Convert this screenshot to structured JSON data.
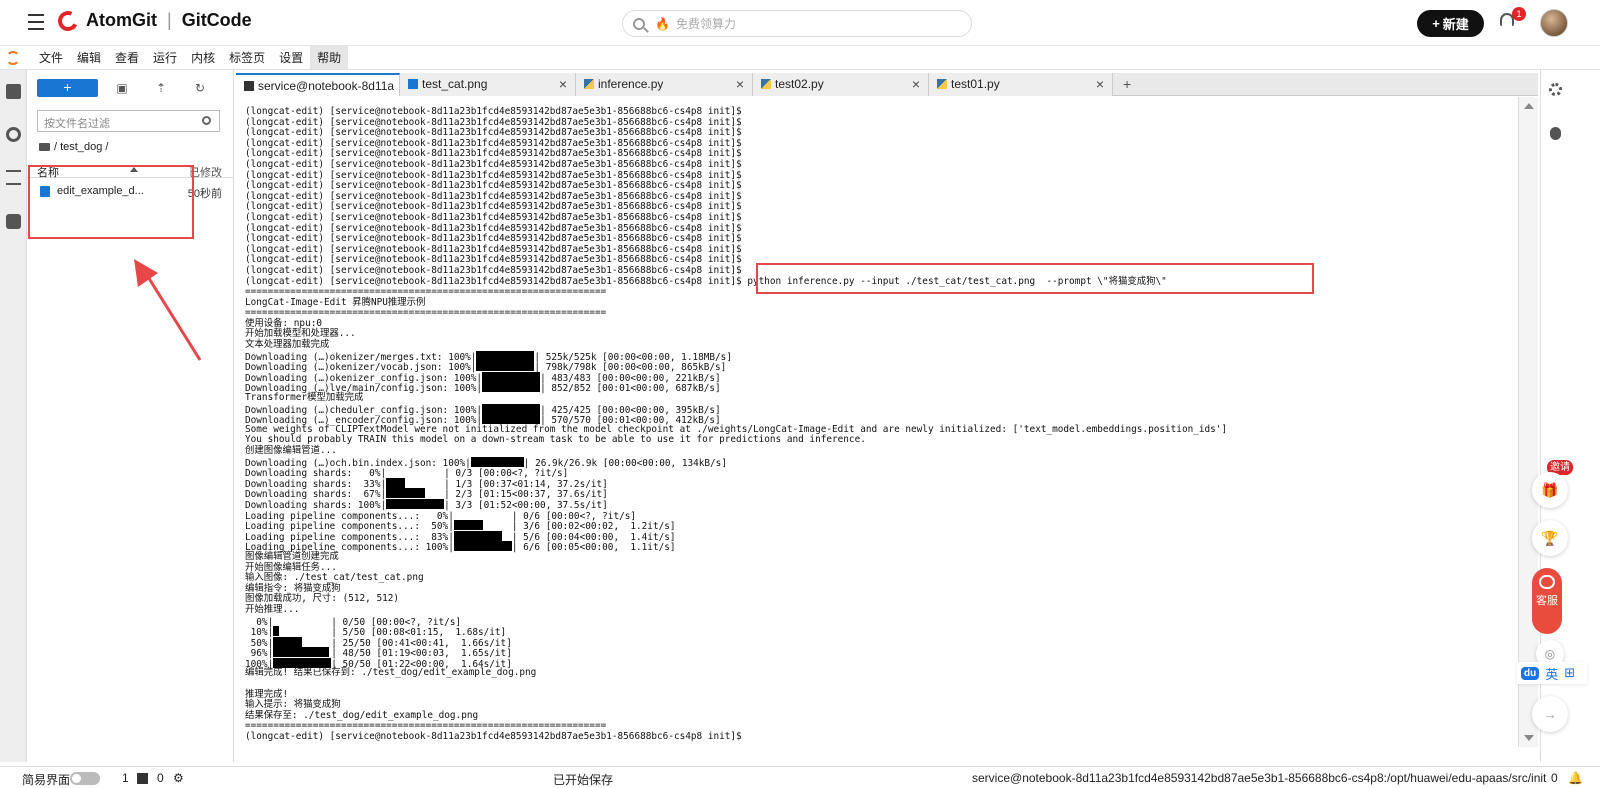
{
  "header": {
    "brand": "AtomGit",
    "product": "GitCode",
    "search_placeholder": "免费领算力",
    "new_label": "新建",
    "notification_count": "1"
  },
  "menu": {
    "items": [
      "文件",
      "编辑",
      "查看",
      "运行",
      "内核",
      "标签页",
      "设置",
      "帮助"
    ],
    "active": "帮助"
  },
  "filebrowser": {
    "filter_placeholder": "按文件名过滤",
    "path": "/ test_dog /",
    "col_name": "名称",
    "col_modified": "已修改",
    "rows": [
      {
        "name": "edit_example_d...",
        "modified": "50秒前"
      }
    ]
  },
  "tabs": [
    {
      "label": "service@notebook-8d11a2",
      "kind": "terminal",
      "active": true
    },
    {
      "label": "test_cat.png",
      "kind": "image",
      "active": false
    },
    {
      "label": "inference.py",
      "kind": "python",
      "active": false
    },
    {
      "label": "test02.py",
      "kind": "python",
      "active": false
    },
    {
      "label": "test01.py",
      "kind": "python",
      "active": false
    }
  ],
  "terminal": {
    "prompt": "(longcat-edit) [service@notebook-8d11a23b1fcd4e8593142bd87ae5e3b1-856688bc6-cs4p8 init]$",
    "command": " python inference.py --input ./test_cat/test_cat.png  --prompt \\\"将猫变成狗\\\"",
    "separator": "================================================================",
    "title": "LongCat-Image-Edit 昇腾NPU推理示例",
    "lines1": [
      "使用设备: npu:0",
      "开始加载模型和处理器...",
      "文本处理器加载完成"
    ],
    "downloads1": [
      {
        "label": "Downloading (…)okenizer/merges.txt: 100%",
        "stat": "| 525k/525k [00:00<00:00, 1.18MB/s]"
      },
      {
        "label": "Downloading (…)okenizer/vocab.json: 100%",
        "stat": "| 798k/798k [00:00<00:00, 865kB/s]"
      },
      {
        "label": "Downloading (…)okenizer_config.json: 100%",
        "stat": "| 483/483 [00:00<00:00, 221kB/s]"
      },
      {
        "label": "Downloading (…)lve/main/config.json: 100%",
        "stat": "| 852/852 [00:01<00:00, 687kB/s]"
      }
    ],
    "transformer_done": "Transformer模型加载完成",
    "downloads2": [
      {
        "label": "Downloading (…)cheduler_config.json: 100%",
        "stat": "| 425/425 [00:00<00:00, 395kB/s]"
      },
      {
        "label": "Downloading (…)_encoder/config.json: 100%",
        "stat": "| 570/570 [00:01<00:00, 412kB/s]"
      }
    ],
    "warn1": "Some weights of CLIPTextModel were not initialized from the model checkpoint at ./weights/LongCat-Image-Edit and are newly initialized: ['text_model.embeddings.position_ids']",
    "warn2": "You should probably TRAIN this model on a down-stream task to be able to use it for predictions and inference.",
    "create_pipeline": "创建图像编辑管道...",
    "download3": {
      "label": "Downloading (…)och.bin.index.json: 100%",
      "stat": "| 26.9k/26.9k [00:00<00:00, 134kB/s]"
    },
    "shards": [
      {
        "label": "Downloading shards:   0%",
        "stat": "| 0/3 [00:00<?, ?it/s]",
        "fill": 0
      },
      {
        "label": "Downloading shards:  33%",
        "stat": "| 1/3 [00:37<01:14, 37.2s/it]",
        "fill": 0.33
      },
      {
        "label": "Downloading shards:  67%",
        "stat": "| 2/3 [01:15<00:37, 37.6s/it]",
        "fill": 0.67
      },
      {
        "label": "Downloading shards: 100%",
        "stat": "| 3/3 [01:52<00:00, 37.5s/it]",
        "fill": 1
      }
    ],
    "pipeline": [
      {
        "label": "Loading pipeline components...:   0%",
        "stat": "| 0/6 [00:00<?, ?it/s]",
        "fill": 0
      },
      {
        "label": "Loading pipeline components...:  50%",
        "stat": "| 3/6 [00:02<00:02,  1.2it/s]",
        "fill": 0.5
      },
      {
        "label": "Loading pipeline components...:  83%",
        "stat": "| 5/6 [00:04<00:00,  1.4it/s]",
        "fill": 0.83
      },
      {
        "label": "Loading pipeline components...: 100%",
        "stat": "| 6/6 [00:05<00:00,  1.1it/s]",
        "fill": 1
      }
    ],
    "lines2": [
      "图像编辑管道创建完成",
      "开始图像编辑任务...",
      "输入图像: ./test_cat/test_cat.png",
      "编辑指令: 将猫变成狗",
      "图像加载成功, 尺寸: (512, 512)",
      "开始推理..."
    ],
    "infer": [
      {
        "label": "  0%",
        "stat": "| 0/50 [00:00<?, ?it/s]",
        "fill": 0
      },
      {
        "label": " 10%",
        "stat": "| 5/50 [00:08<01:15,  1.68s/it]",
        "fill": 0.1
      },
      {
        "label": " 50%",
        "stat": "| 25/50 [00:41<00:41,  1.66s/it]",
        "fill": 0.5
      },
      {
        "label": " 96%",
        "stat": "| 48/50 [01:19<00:03,  1.65s/it]",
        "fill": 0.96
      },
      {
        "label": "100%",
        "stat": "| 50/50 [01:22<00:00,  1.64s/it]",
        "fill": 1
      }
    ],
    "lines3": [
      "编辑完成! 结果已保存到: ./test_dog/edit_example_dog.png",
      "",
      "推理完成!",
      "输入提示: 将猫变成狗",
      "结果保存至: ./test_dog/edit_example_dog.png"
    ]
  },
  "widgets": {
    "invite": "邀请",
    "kefu": "客服",
    "ime_logo": "du",
    "ime_lang": "英",
    "ime_grid": "⊞"
  },
  "statusbar": {
    "simple_mode": "简易界面",
    "terminals": "1",
    "kernels": "0",
    "saved": "已开始保存",
    "path": "service@notebook-8d11a23b1fcd4e8593142bd87ae5e3b1-856688bc6-cs4p8:/opt/huawei/edu-apaas/src/init",
    "count": "0"
  }
}
